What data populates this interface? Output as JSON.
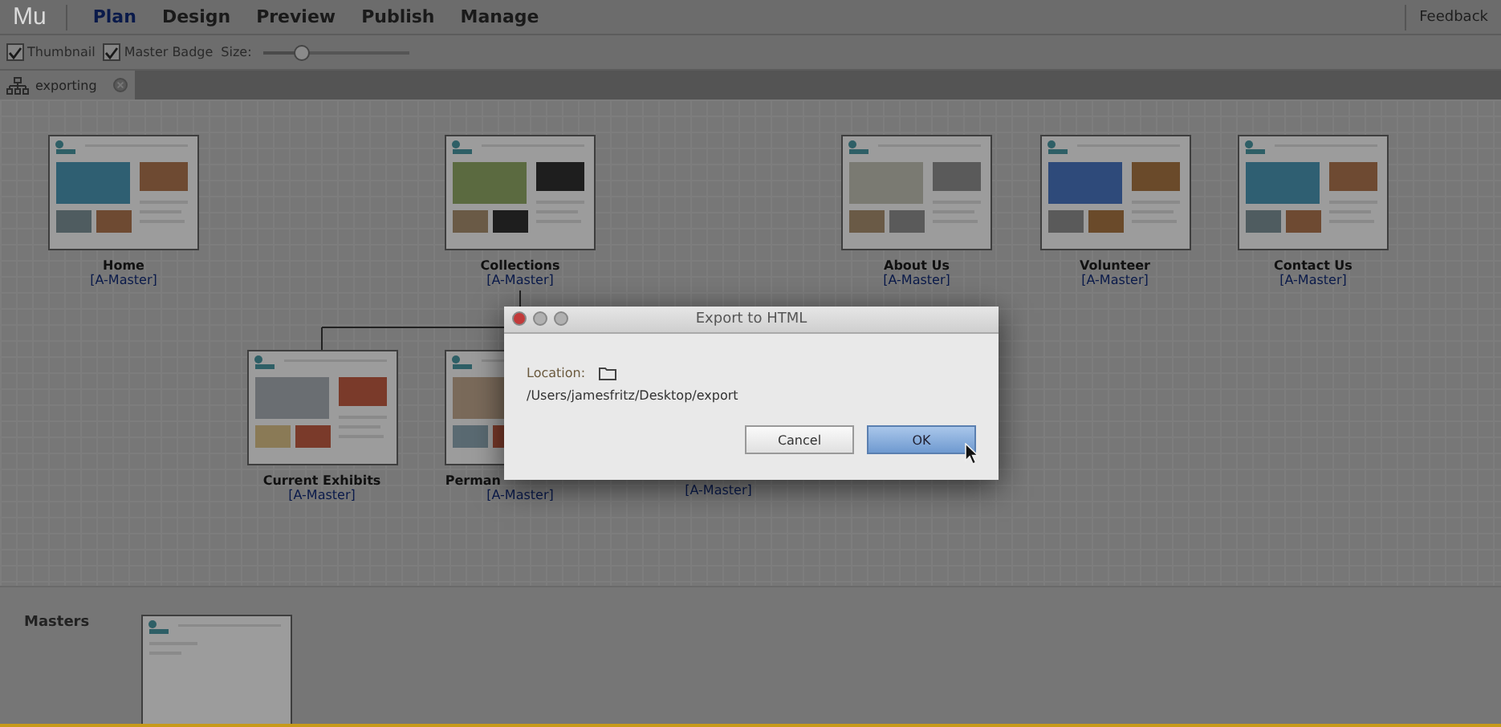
{
  "app": {
    "logo": "Mu",
    "menu": [
      {
        "label": "Plan",
        "selected": true
      },
      {
        "label": "Design",
        "selected": false
      },
      {
        "label": "Preview",
        "selected": false
      },
      {
        "label": "Publish",
        "selected": false
      },
      {
        "label": "Manage",
        "selected": false
      }
    ],
    "feedback": "Feedback"
  },
  "toolbar": {
    "options": [
      {
        "label": "Thumbnail",
        "checked": true
      },
      {
        "label": "Master Badge",
        "checked": true
      }
    ],
    "size_label": "Size:",
    "size_slider": {
      "level": 0.27
    }
  },
  "tabs": [
    {
      "label": "exporting",
      "selected": true
    }
  ],
  "sitemap": {
    "pages": [
      {
        "title": "Home",
        "master": "[A-Master]"
      },
      {
        "title": "Collections",
        "master": "[A-Master]",
        "children": [
          {
            "title": "Current Exhibits",
            "master": "[A-Master]"
          },
          {
            "title": "Perman",
            "master": "[A-Master]"
          },
          {
            "master": "[A-Master]"
          }
        ]
      },
      {
        "title": "About Us",
        "master": "[A-Master]"
      },
      {
        "title": "Volunteer",
        "master": "[A-Master]"
      },
      {
        "title": "Contact Us",
        "master": "[A-Master]"
      }
    ]
  },
  "masters": {
    "label": "Masters"
  },
  "dialog": {
    "title": "Export to HTML",
    "location_label": "Location:",
    "path": "/Users/jamesfritz/Desktop/export",
    "buttons": [
      {
        "label": "Cancel",
        "kind": "secondary"
      },
      {
        "label": "OK",
        "kind": "primary"
      }
    ]
  }
}
